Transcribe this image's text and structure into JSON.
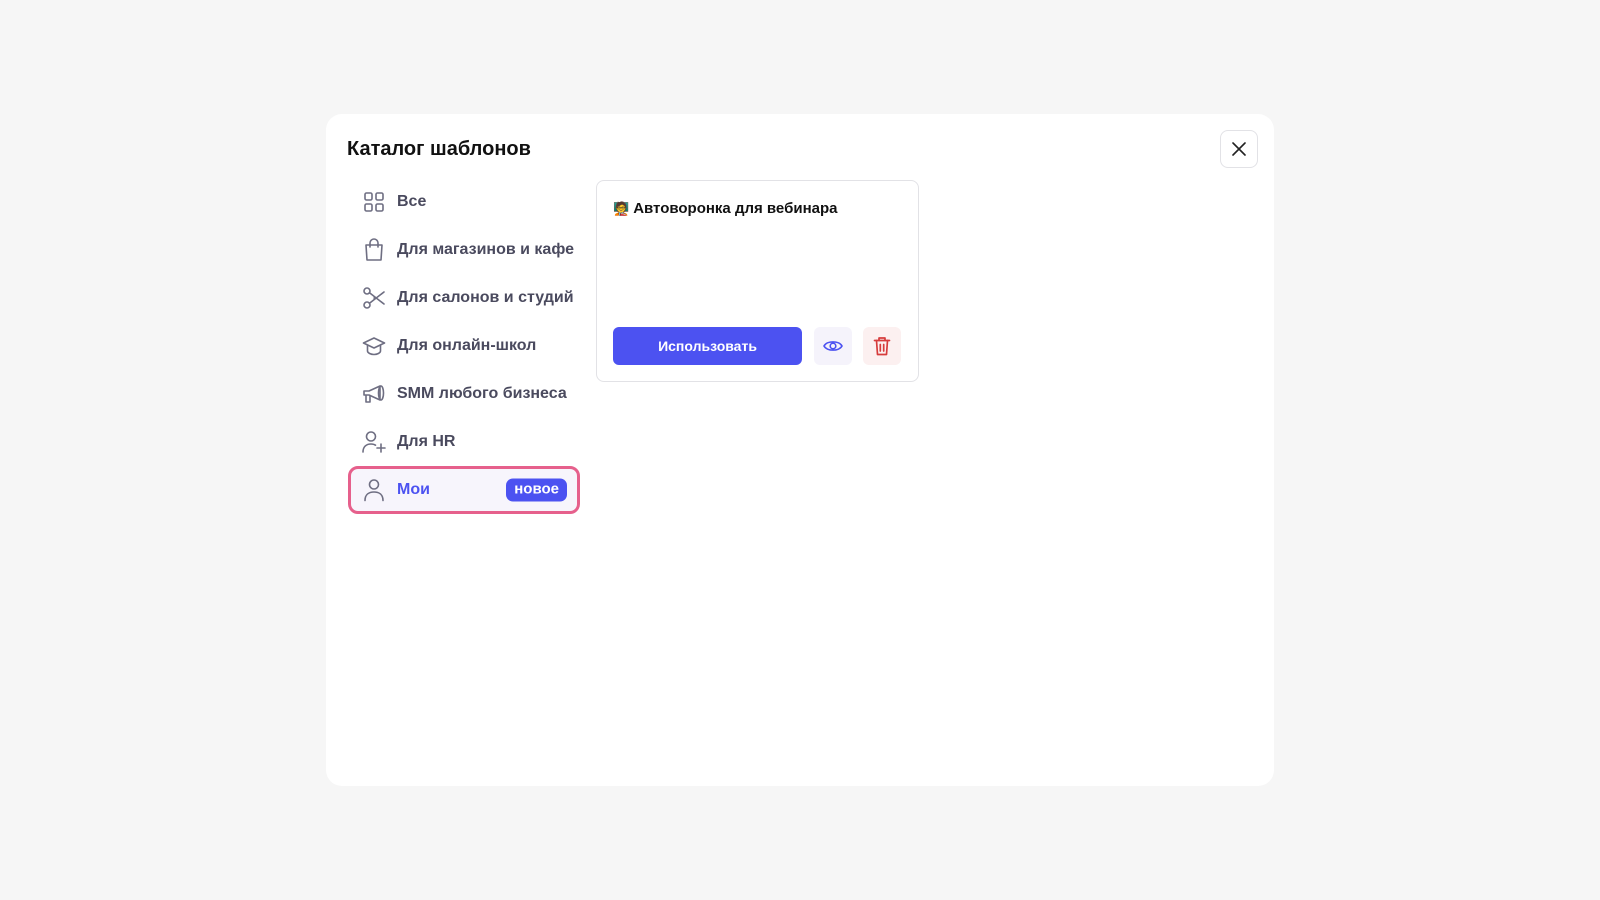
{
  "modal": {
    "title": "Каталог шаблонов",
    "close_icon": "close-icon"
  },
  "sidebar": {
    "items": [
      {
        "label": "Все",
        "icon": "grid-icon"
      },
      {
        "label": "Для магазинов и кафе",
        "icon": "shopping-bag-icon"
      },
      {
        "label": "Для салонов и студий",
        "icon": "scissors-icon"
      },
      {
        "label": "Для онлайн-школ",
        "icon": "graduation-cap-icon"
      },
      {
        "label": "SMM любого бизнеса",
        "icon": "megaphone-icon"
      },
      {
        "label": "Для HR",
        "icon": "user-plus-icon"
      },
      {
        "label": "Мои",
        "icon": "user-icon",
        "badge": "новое",
        "active": true
      }
    ]
  },
  "template_card": {
    "emoji": "🧑‍🏫",
    "title": "Автоворонка для вебинара",
    "use_button_label": "Использовать",
    "preview_icon": "eye-icon",
    "delete_icon": "trash-icon"
  },
  "colors": {
    "accent": "#4c52f1",
    "active_border": "#e6608c",
    "delete": "#d63c3c",
    "text_muted": "#4a4a5e"
  }
}
